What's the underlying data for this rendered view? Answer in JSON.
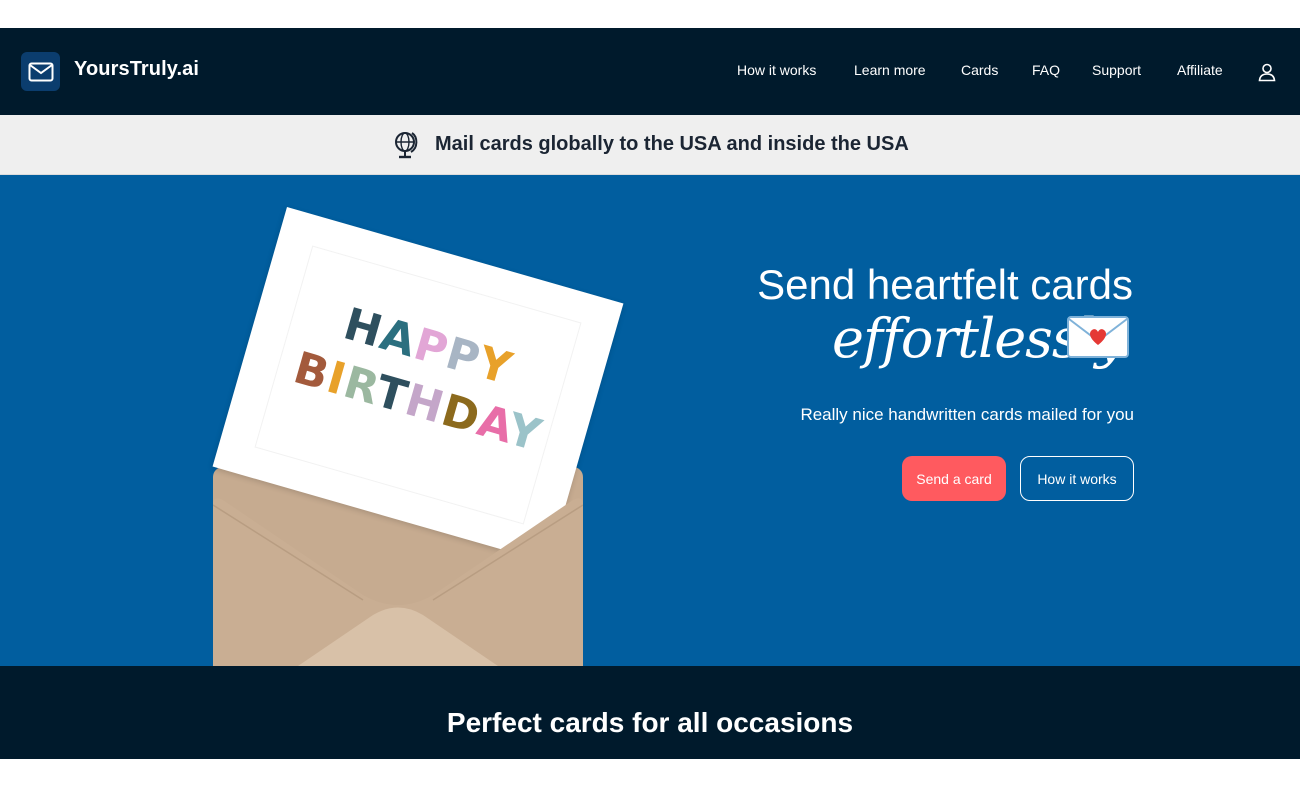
{
  "brand": {
    "name": "YoursTruly.ai",
    "logo_icon": "envelope-icon"
  },
  "nav": {
    "items": [
      {
        "label": "How it works"
      },
      {
        "label": "Learn more"
      },
      {
        "label": "Cards"
      },
      {
        "label": "FAQ"
      },
      {
        "label": "Support"
      },
      {
        "label": "Affiliate"
      }
    ],
    "account_icon": "user-icon"
  },
  "banner": {
    "icon": "globe-icon",
    "text": "Mail cards globally to the USA and inside the USA"
  },
  "hero": {
    "title": "Send heartfelt cards",
    "script_word": "effortlessly",
    "script_icon": "love-letter-icon",
    "subtitle": "Really nice handwritten cards mailed for you",
    "primary_button": "Send a card",
    "secondary_button": "How it works",
    "card_art": {
      "line1": "HAPPY",
      "line2": "BIRTHDAY",
      "letter_colors_line1": [
        "#2e4f5e",
        "#2b6f7f",
        "#e2a6d6",
        "#a8b5c4",
        "#e8a12a"
      ],
      "letter_colors_line2": [
        "#a35a3c",
        "#e8a12a",
        "#9bb8a0",
        "#2e4f5e",
        "#c4a6c9",
        "#8c6a1d",
        "#e86ea8",
        "#9bc3c9"
      ]
    }
  },
  "occasions": {
    "title": "Perfect cards for all occasions"
  },
  "colors": {
    "navbar": "#001a2c",
    "hero": "#015e9f",
    "accent": "#ff5a5f",
    "banner": "#efefef"
  }
}
